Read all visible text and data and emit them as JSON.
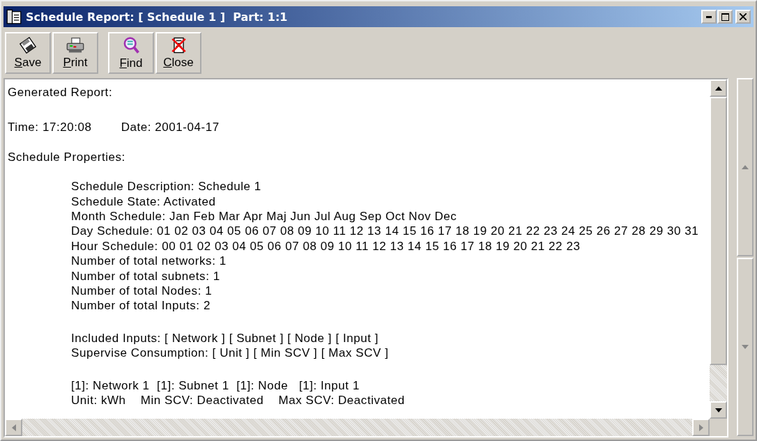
{
  "window": {
    "title": "Schedule Report: [ Schedule 1 ]  Part: 1:1"
  },
  "toolbar_groups": [
    [
      {
        "kind": "save",
        "accel": "S",
        "rest": "ave"
      },
      {
        "kind": "print",
        "accel": "P",
        "rest": "rint"
      }
    ],
    [
      {
        "kind": "find",
        "accel": "F",
        "rest": "ind"
      },
      {
        "kind": "close",
        "accel": "C",
        "rest": "lose"
      }
    ]
  ],
  "report": [
    {
      "indented": false,
      "lines": [
        "Generated Report:"
      ]
    },
    {
      "indented": false,
      "lines": [
        "Time: 17:20:08        Date: 2001-04-17"
      ]
    },
    {
      "indented": false,
      "lines": [
        "Schedule Properties:"
      ]
    },
    {
      "indented": true,
      "lines": [
        "Schedule Description: Schedule 1",
        "Schedule State: Activated",
        "Month Schedule: Jan Feb Mar Apr Maj Jun Jul Aug Sep Oct Nov Dec",
        "Day Schedule: 01 02 03 04 05 06 07 08 09 10 11 12 13 14 15 16 17 18 19 20 21 22 23 24 25 26 27 28 29 30 31",
        "Hour Schedule: 00 01 02 03 04 05 06 07 08 09 10 11 12 13 14 15 16 17 18 19 20 21 22 23",
        "Number of total networks: 1",
        "Number of total subnets: 1",
        "Number of total Nodes: 1",
        "Number of total Inputs: 2"
      ]
    },
    {
      "indented": true,
      "lines": [
        "Included Inputs: [ Network ] [ Subnet ] [ Node ] [ Input ]",
        "Supervise Consumption: [ Unit ] [ Min SCV ] [ Max SCV ]"
      ]
    },
    {
      "indented": true,
      "lines": [
        "[1]: Network 1  [1]: Subnet 1  [1]: Node   [1]: Input 1",
        "Unit: kWh    Min SCV: Deactivated    Max SCV: Deactivated"
      ]
    }
  ]
}
